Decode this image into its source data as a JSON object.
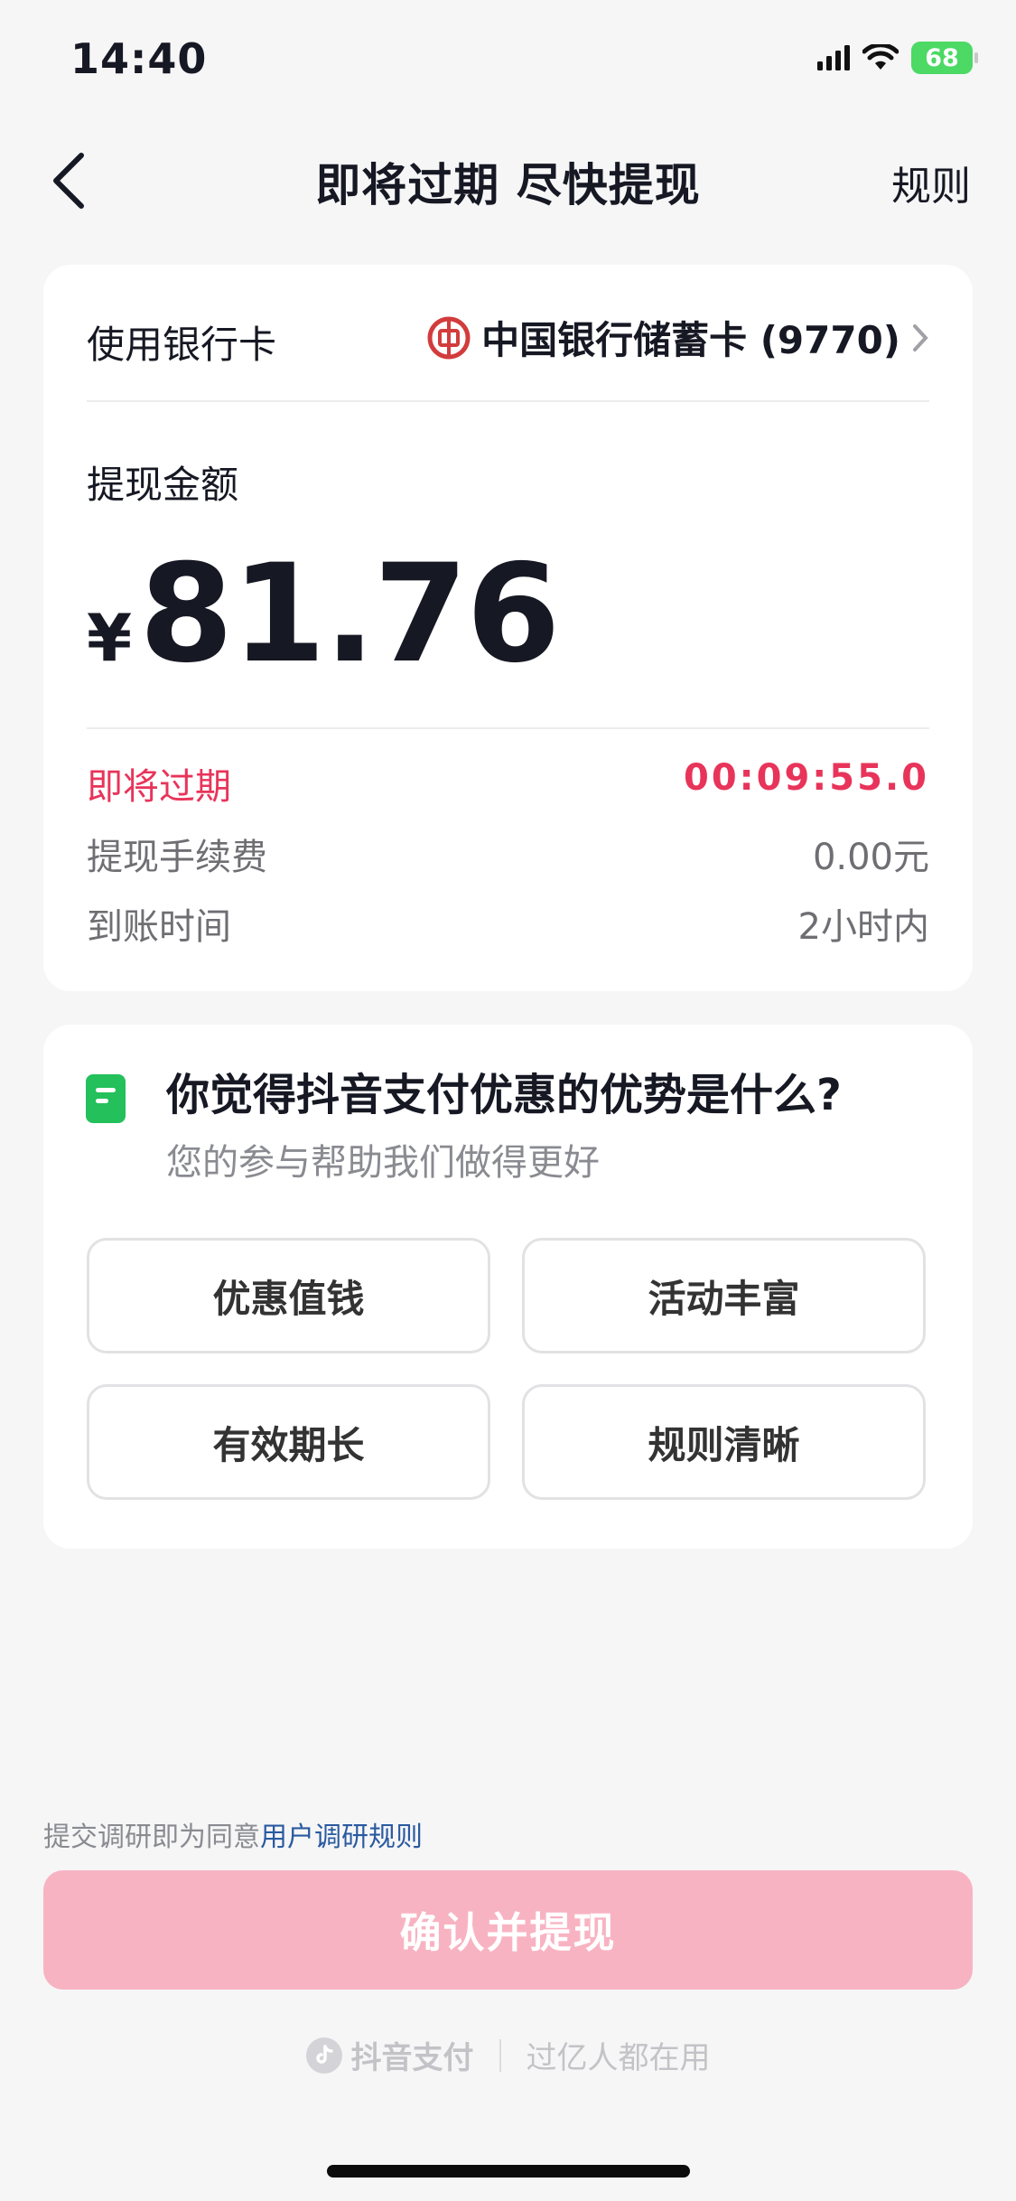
{
  "status_bar": {
    "time": "14:40",
    "battery": "68"
  },
  "nav": {
    "title": "即将过期 尽快提现",
    "rule": "规则"
  },
  "withdraw": {
    "bank_label": "使用银行卡",
    "bank_name": "中国银行储蓄卡 (9770)",
    "amount_label": "提现金额",
    "currency": "¥",
    "amount": "81.76",
    "expire_label": "即将过期",
    "countdown": "00:09:55.0",
    "fee_label": "提现手续费",
    "fee_value": "0.00元",
    "time_label": "到账时间",
    "time_value": "2小时内"
  },
  "survey": {
    "title": "你觉得抖音支付优惠的优势是什么?",
    "subtitle": "您的参与帮助我们做得更好",
    "options": [
      "优惠值钱",
      "活动丰富",
      "有效期长",
      "规则清晰"
    ]
  },
  "agreement": {
    "prefix": "提交调研即为同意",
    "link": "用户调研规则"
  },
  "confirm": {
    "label": "确认并提现"
  },
  "footer": {
    "brand": "抖音支付",
    "slogan": "过亿人都在用"
  },
  "colors": {
    "accent_red": "#e8345a",
    "button_pink": "#f8b3c2",
    "survey_green": "#23c05b",
    "link_blue": "#2a5aa0"
  }
}
